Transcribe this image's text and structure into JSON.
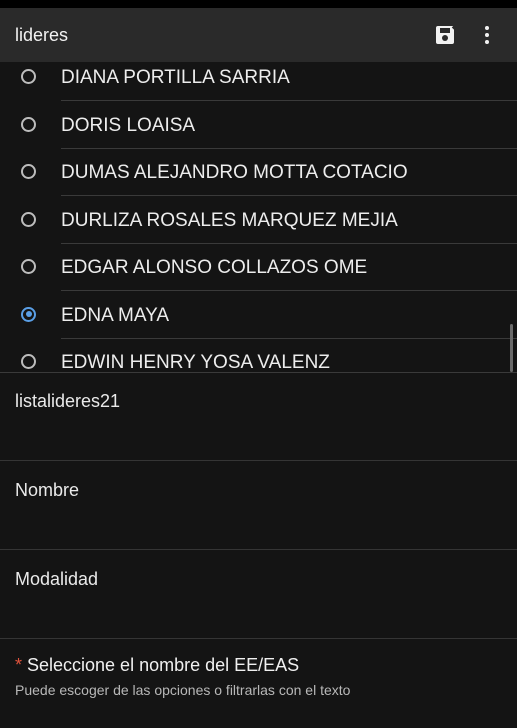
{
  "app_bar": {
    "title": "lideres",
    "save_icon": "save-icon",
    "menu_icon": "more-vert-icon"
  },
  "options": [
    {
      "label": "DIANA PORTILLA SARRIA",
      "selected": false
    },
    {
      "label": "DORIS LOAISA",
      "selected": false
    },
    {
      "label": "DUMAS ALEJANDRO MOTTA COTACIO",
      "selected": false
    },
    {
      "label": "DURLIZA ROSALES MARQUEZ MEJIA",
      "selected": false
    },
    {
      "label": "EDGAR ALONSO COLLAZOS OME",
      "selected": false
    },
    {
      "label": "EDNA MAYA",
      "selected": true
    },
    {
      "label": "EDWIN HENRY YOSA VALENZ",
      "selected": false
    }
  ],
  "fields": [
    {
      "label": "listalideres21"
    },
    {
      "label": "Nombre"
    },
    {
      "label": "Modalidad"
    }
  ],
  "question": {
    "required_mark": "*",
    "label": "Seleccione el nombre del EE/EAS",
    "hint": "Puede escoger de las opciones o filtrarlas con el texto"
  },
  "colors": {
    "accent": "#5a9fe6",
    "required": "#e0533d",
    "background": "#141414",
    "app_bar": "#2a2a2a"
  }
}
